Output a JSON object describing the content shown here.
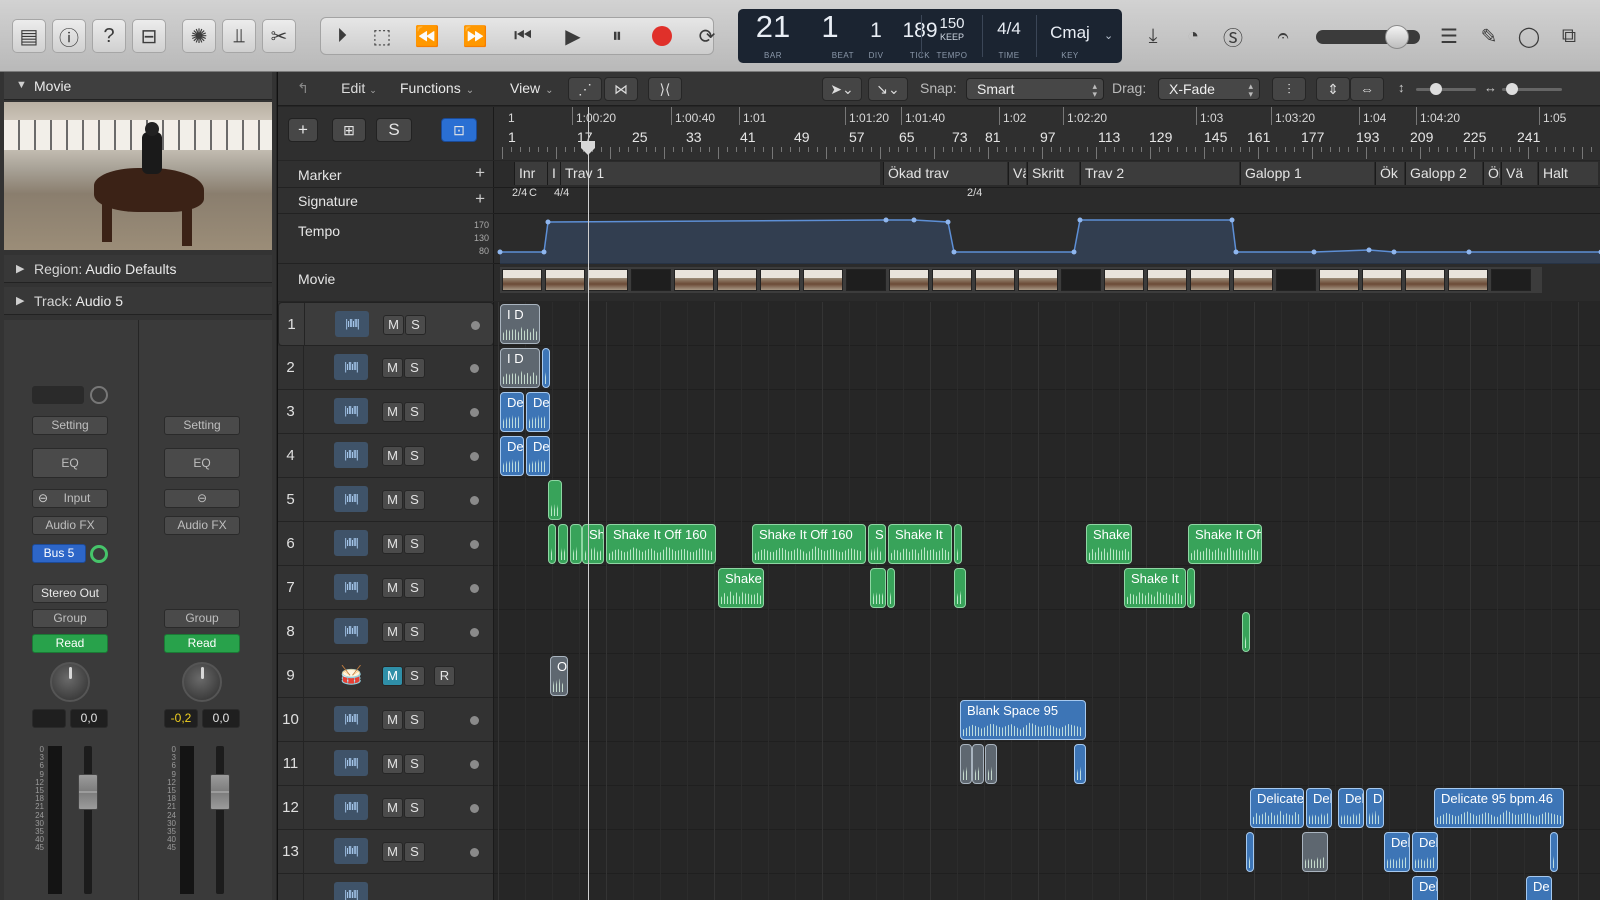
{
  "control_bar": {
    "lcd": {
      "bar": "21",
      "beat": "1",
      "div": "1",
      "tick": "189",
      "bar_label": "BAR",
      "beat_label": "BEAT",
      "div_label": "DIV",
      "tick_label": "TICK",
      "tempo": "150",
      "tempo_mode": "KEEP",
      "tempo_label": "TEMPO",
      "time_sig": "4/4",
      "time_label": "TIME",
      "key": "Cmaj",
      "key_label": "KEY"
    },
    "master_volume_level": 0.78,
    "record_color": "#e0302a"
  },
  "inspector": {
    "movie_header": "Movie",
    "region_label": "Region:",
    "region_value": "Audio Defaults",
    "track_label": "Track:",
    "track_value": "Audio 5",
    "strip1": {
      "setting": "Setting",
      "eq": "EQ",
      "input": "Input",
      "audio_fx": "Audio FX",
      "send": "Bus 5",
      "output": "Stereo Out",
      "group": "Group",
      "automation": "Read",
      "value": "0,0"
    },
    "strip2": {
      "setting": "Setting",
      "eq": "EQ",
      "audio_fx": "Audio FX",
      "group": "Group",
      "automation": "Read",
      "peak": "-0,2",
      "value": "0,0"
    },
    "meter_scale": [
      "0",
      "3",
      "6",
      "9",
      "12",
      "15",
      "18",
      "21",
      "24",
      "30",
      "35",
      "40",
      "45"
    ]
  },
  "toolbar": {
    "edit": "Edit",
    "functions": "Functions",
    "view": "View",
    "snap_label": "Snap:",
    "snap_value": "Smart",
    "drag_label": "Drag:",
    "drag_value": "X-Fade"
  },
  "header": {
    "s_button": "S"
  },
  "ruler": {
    "time_labels": [
      "1:00:20",
      "1:00:40",
      "1:01",
      "1:01:20",
      "1:01:40",
      "1:02",
      "1:02:20",
      "1:03",
      "1:03:20",
      "1:04",
      "1:04:20",
      "1:05"
    ],
    "bar_labels": [
      "1",
      "17",
      "25",
      "33",
      "41",
      "49",
      "57",
      "65",
      "73",
      "81",
      "97",
      "113",
      "129",
      "145",
      "161",
      "177",
      "193",
      "209",
      "225",
      "241"
    ],
    "first_time_label": "1"
  },
  "global_tracks": {
    "marker": "Marker",
    "signature": "Signature",
    "tempo": "Tempo",
    "movie": "Movie",
    "tempo_scale": [
      "170",
      "130",
      "80"
    ],
    "markers": [
      "Inr",
      "I",
      "Trav 1",
      "Ökad trav",
      "Vä",
      "Skritt",
      "Trav 2",
      "Galopp 1",
      "Ök",
      "Galopp 2",
      "Ök",
      "Vä",
      "Halt"
    ],
    "signatures": [
      "2/4",
      "C",
      "4/4",
      "2/4"
    ]
  },
  "tracks": [
    {
      "num": "1",
      "m": "M",
      "s": "S"
    },
    {
      "num": "2",
      "m": "M",
      "s": "S"
    },
    {
      "num": "3",
      "m": "M",
      "s": "S"
    },
    {
      "num": "4",
      "m": "M",
      "s": "S"
    },
    {
      "num": "5",
      "m": "M",
      "s": "S"
    },
    {
      "num": "6",
      "m": "M",
      "s": "S"
    },
    {
      "num": "7",
      "m": "M",
      "s": "S"
    },
    {
      "num": "8",
      "m": "M",
      "s": "S"
    },
    {
      "num": "9",
      "m": "M",
      "s": "S",
      "r": "R"
    },
    {
      "num": "10",
      "m": "M",
      "s": "S"
    },
    {
      "num": "11",
      "m": "M",
      "s": "S"
    },
    {
      "num": "12",
      "m": "M",
      "s": "S"
    },
    {
      "num": "13",
      "m": "M",
      "s": "S"
    }
  ],
  "regions": {
    "r1a": "I D",
    "r2a": "I D",
    "r3a": "Del",
    "r3b": "De",
    "r4a": "Del",
    "r4b": "De",
    "r6a": "Sh",
    "r6b": "Shake It Off 160",
    "r6c": "Shake It Off 160",
    "r6d": "S",
    "r6e": "Shake It",
    "r6f": "Shake",
    "r6g": "Shake It Off",
    "r7a": "Shake",
    "r7b": "Shake It",
    "r9a": "O",
    "r10a": "Blank Space 95",
    "r12a": "Delicate",
    "r12b": "Del",
    "r12c": "Del",
    "r12d": "D",
    "r12e": "Delicate 95 bpm.46",
    "r13a": "Del",
    "r13b": "Del",
    "r14a": "Del",
    "r14b": "De"
  }
}
